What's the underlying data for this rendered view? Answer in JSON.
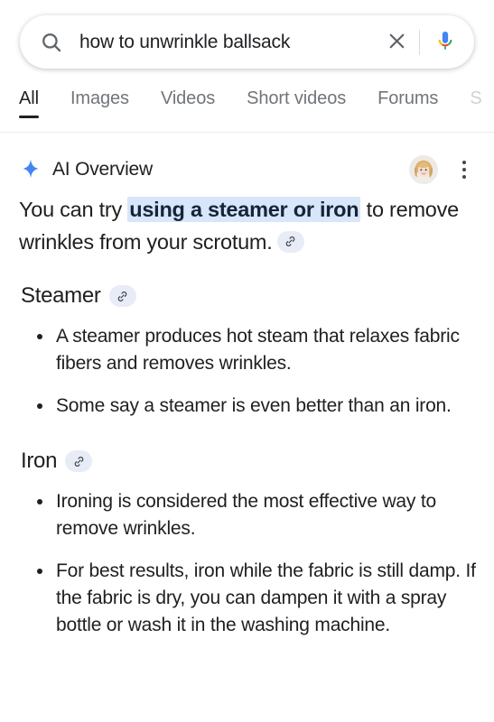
{
  "search": {
    "query": "how to unwrinkle ballsack",
    "placeholder": "Search",
    "search_icon": "search-icon",
    "clear_icon": "close-icon",
    "mic_icon": "microphone-icon"
  },
  "tabs": [
    {
      "label": "All",
      "active": true
    },
    {
      "label": "Images",
      "active": false
    },
    {
      "label": "Videos",
      "active": false
    },
    {
      "label": "Short videos",
      "active": false
    },
    {
      "label": "Forums",
      "active": false
    },
    {
      "label": "S",
      "active": false
    }
  ],
  "ai_overview": {
    "title": "AI Overview",
    "sparkle_icon": "sparkle-icon",
    "avatar_icon": "user-avatar",
    "menu_icon": "more-options-icon",
    "lede": {
      "before": "You can try ",
      "highlight": "using a steamer or iron",
      "after": " to remove wrinkles from your scrotum.",
      "link_icon": "link-icon"
    },
    "sections": [
      {
        "heading": "Steamer",
        "link_icon": "link-icon",
        "bullets": [
          "A steamer produces hot steam that relaxes fabric fibers and removes wrinkles.",
          "Some say a steamer is even better than an iron."
        ]
      },
      {
        "heading": "Iron",
        "link_icon": "link-icon",
        "bullets": [
          "Ironing is considered the most effective way to remove wrinkles.",
          "For best results, iron while the fabric is still damp. If the fabric is dry, you can dampen it with a spray bottle or wash it in the washing machine."
        ]
      }
    ]
  },
  "colors": {
    "highlight_bg": "#d7e6f8",
    "chip_bg": "#e8ecf7",
    "text": "#1f1f1f",
    "muted_text": "#70757a",
    "sparkle_blue": "#4285f4",
    "mic_blue": "#4285f4",
    "mic_red": "#ea4335",
    "mic_yellow": "#fbbc05",
    "mic_green": "#34a853"
  }
}
